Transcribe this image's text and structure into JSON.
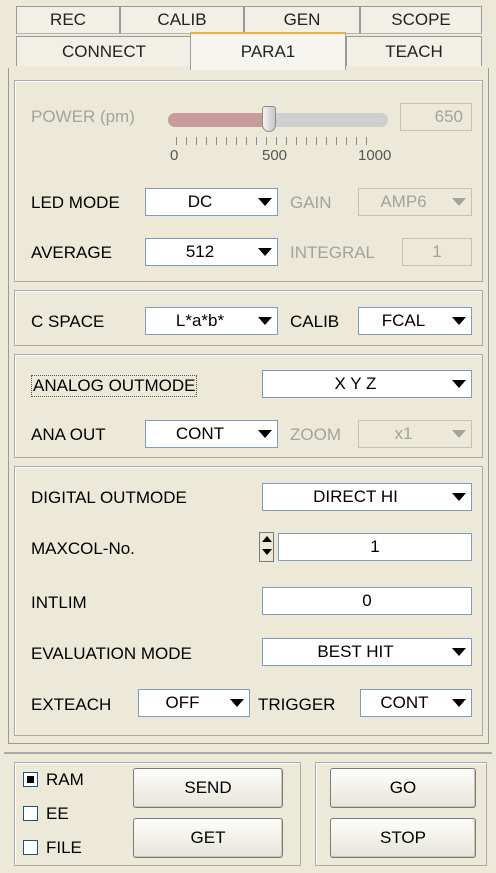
{
  "tabs_row1": [
    "REC",
    "CALIB",
    "GEN",
    "SCOPE"
  ],
  "tabs_row2": [
    "CONNECT",
    "PARA1",
    "TEACH"
  ],
  "power": {
    "label": "POWER (pm)",
    "value": "650",
    "level": 650,
    "max": 1000,
    "ticks": [
      "0",
      "500",
      "1000"
    ]
  },
  "led_mode": {
    "label": "LED MODE",
    "value": "DC"
  },
  "gain": {
    "label": "GAIN",
    "value": "AMP6"
  },
  "average": {
    "label": "AVERAGE",
    "value": "512"
  },
  "integral": {
    "label": "INTEGRAL",
    "value": "1"
  },
  "c_space": {
    "label": "C SPACE",
    "value": "L*a*b*"
  },
  "calib": {
    "label": "CALIB",
    "value": "FCAL"
  },
  "analog_outmode": {
    "label": "ANALOG OUTMODE",
    "value": "X Y Z"
  },
  "ana_out": {
    "label": "ANA OUT",
    "value": "CONT"
  },
  "zoom": {
    "label": "ZOOM",
    "value": "x1"
  },
  "digital_outmode": {
    "label": "DIGITAL OUTMODE",
    "value": "DIRECT HI"
  },
  "maxcol": {
    "label": "MAXCOL-No.",
    "value": "1"
  },
  "intlim": {
    "label": "INTLIM",
    "value": "0"
  },
  "evaluation_mode": {
    "label": "EVALUATION MODE",
    "value": "BEST HIT"
  },
  "exteach": {
    "label": "EXTEACH",
    "value": "OFF"
  },
  "trigger": {
    "label": "TRIGGER",
    "value": "CONT"
  },
  "memory": {
    "ram": "RAM",
    "ee": "EE",
    "file": "FILE"
  },
  "buttons": {
    "send": "SEND",
    "get": "GET",
    "go": "GO",
    "stop": "STOP"
  },
  "colors": {
    "accent_tab": "#f0b040",
    "slider_fill": "#c99b9b"
  }
}
